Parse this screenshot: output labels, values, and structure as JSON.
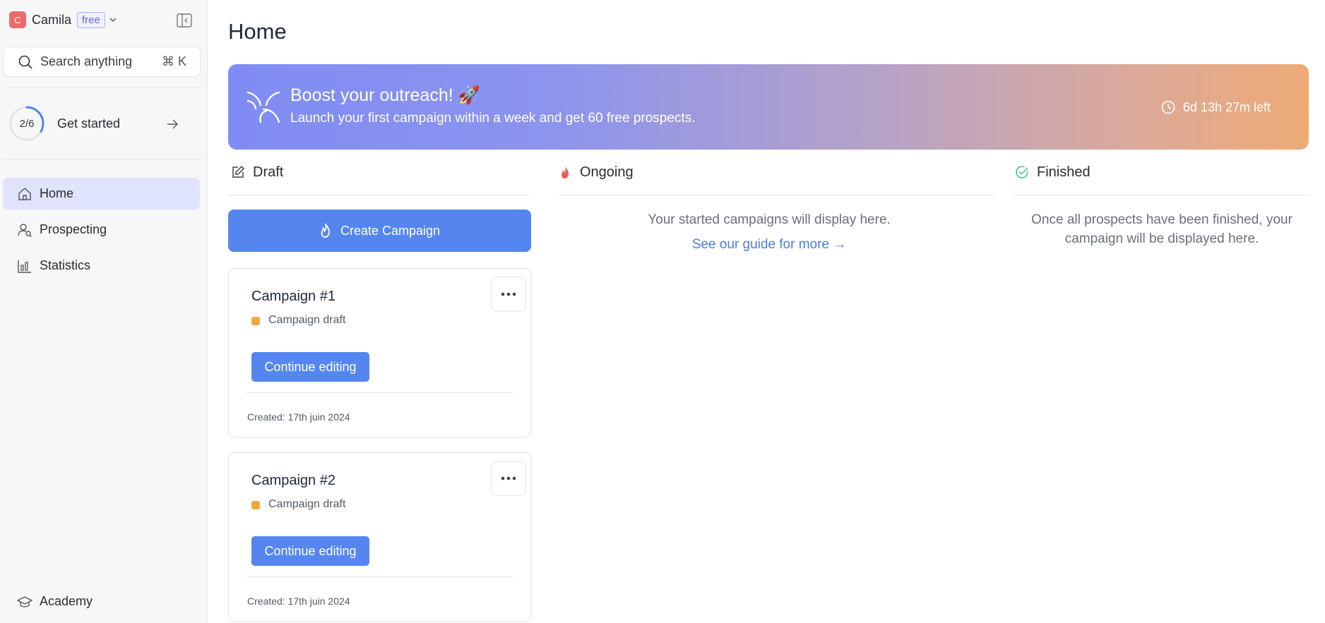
{
  "workspace": {
    "avatar": "C",
    "name": "Camila",
    "plan_badge": "free"
  },
  "search": {
    "placeholder": "Search anything",
    "shortcut": "⌘ K"
  },
  "onboarding": {
    "progress_text": "2/6",
    "progress_fraction": 0.333,
    "label": "Get started"
  },
  "nav": {
    "items": [
      {
        "label": "Home",
        "icon": "home-icon",
        "active": true
      },
      {
        "label": "Prospecting",
        "icon": "user-search-icon",
        "active": false
      },
      {
        "label": "Statistics",
        "icon": "bar-chart-icon",
        "active": false
      }
    ],
    "bottom": {
      "label": "Academy",
      "icon": "graduation-cap-icon"
    }
  },
  "page": {
    "title": "Home"
  },
  "banner": {
    "title": "Boost your outreach! 🚀",
    "subtitle": "Launch your first campaign within a week and get 60 free prospects.",
    "timer": "6d 13h 27m left"
  },
  "columns": {
    "draft": {
      "label": "Draft",
      "icon": "edit-icon"
    },
    "ongoing": {
      "label": "Ongoing",
      "icon": "flame-icon",
      "empty_text": "Your started campaigns will display here.",
      "link": "See our guide for more →"
    },
    "finished": {
      "label": "Finished",
      "icon": "check-circle-icon",
      "empty_text_line1": "Once all prospects have been finished, your",
      "empty_text_line2": "campaign will be displayed here."
    }
  },
  "create_button": {
    "label": "Create Campaign"
  },
  "campaigns": [
    {
      "title": "Campaign #1",
      "status": "Campaign draft",
      "action": "Continue editing",
      "created": "Created: 17th juin 2024"
    },
    {
      "title": "Campaign #2",
      "status": "Campaign draft",
      "action": "Continue editing",
      "created": "Created: 17th juin 2024"
    }
  ],
  "colors": {
    "accent": "#5586f0",
    "draft_status": "#f2a93b",
    "active_nav": "#dfe3fb",
    "flame": "#ef5a5a",
    "check": "#34c08a"
  }
}
